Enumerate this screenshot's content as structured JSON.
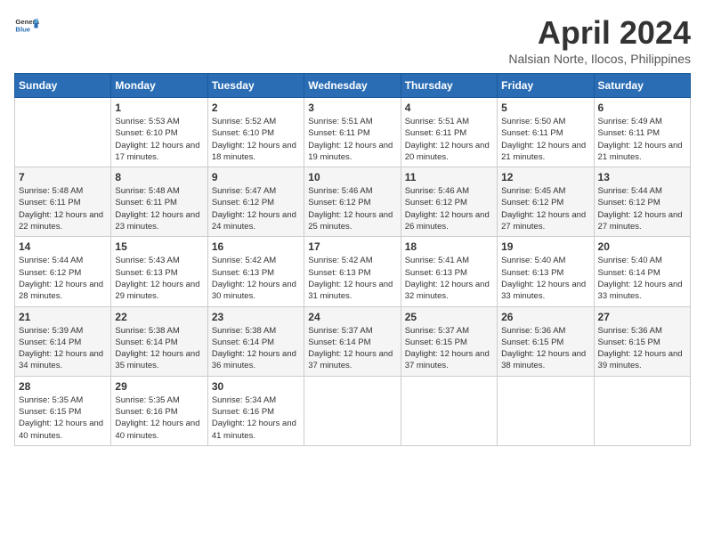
{
  "header": {
    "logo_general": "General",
    "logo_blue": "Blue",
    "month_title": "April 2024",
    "location": "Nalsian Norte, Ilocos, Philippines"
  },
  "calendar": {
    "weekdays": [
      "Sunday",
      "Monday",
      "Tuesday",
      "Wednesday",
      "Thursday",
      "Friday",
      "Saturday"
    ],
    "weeks": [
      [
        {
          "day": "",
          "sunrise": "",
          "sunset": "",
          "daylight": ""
        },
        {
          "day": "1",
          "sunrise": "Sunrise: 5:53 AM",
          "sunset": "Sunset: 6:10 PM",
          "daylight": "Daylight: 12 hours and 17 minutes."
        },
        {
          "day": "2",
          "sunrise": "Sunrise: 5:52 AM",
          "sunset": "Sunset: 6:10 PM",
          "daylight": "Daylight: 12 hours and 18 minutes."
        },
        {
          "day": "3",
          "sunrise": "Sunrise: 5:51 AM",
          "sunset": "Sunset: 6:11 PM",
          "daylight": "Daylight: 12 hours and 19 minutes."
        },
        {
          "day": "4",
          "sunrise": "Sunrise: 5:51 AM",
          "sunset": "Sunset: 6:11 PM",
          "daylight": "Daylight: 12 hours and 20 minutes."
        },
        {
          "day": "5",
          "sunrise": "Sunrise: 5:50 AM",
          "sunset": "Sunset: 6:11 PM",
          "daylight": "Daylight: 12 hours and 21 minutes."
        },
        {
          "day": "6",
          "sunrise": "Sunrise: 5:49 AM",
          "sunset": "Sunset: 6:11 PM",
          "daylight": "Daylight: 12 hours and 21 minutes."
        }
      ],
      [
        {
          "day": "7",
          "sunrise": "Sunrise: 5:48 AM",
          "sunset": "Sunset: 6:11 PM",
          "daylight": "Daylight: 12 hours and 22 minutes."
        },
        {
          "day": "8",
          "sunrise": "Sunrise: 5:48 AM",
          "sunset": "Sunset: 6:11 PM",
          "daylight": "Daylight: 12 hours and 23 minutes."
        },
        {
          "day": "9",
          "sunrise": "Sunrise: 5:47 AM",
          "sunset": "Sunset: 6:12 PM",
          "daylight": "Daylight: 12 hours and 24 minutes."
        },
        {
          "day": "10",
          "sunrise": "Sunrise: 5:46 AM",
          "sunset": "Sunset: 6:12 PM",
          "daylight": "Daylight: 12 hours and 25 minutes."
        },
        {
          "day": "11",
          "sunrise": "Sunrise: 5:46 AM",
          "sunset": "Sunset: 6:12 PM",
          "daylight": "Daylight: 12 hours and 26 minutes."
        },
        {
          "day": "12",
          "sunrise": "Sunrise: 5:45 AM",
          "sunset": "Sunset: 6:12 PM",
          "daylight": "Daylight: 12 hours and 27 minutes."
        },
        {
          "day": "13",
          "sunrise": "Sunrise: 5:44 AM",
          "sunset": "Sunset: 6:12 PM",
          "daylight": "Daylight: 12 hours and 27 minutes."
        }
      ],
      [
        {
          "day": "14",
          "sunrise": "Sunrise: 5:44 AM",
          "sunset": "Sunset: 6:12 PM",
          "daylight": "Daylight: 12 hours and 28 minutes."
        },
        {
          "day": "15",
          "sunrise": "Sunrise: 5:43 AM",
          "sunset": "Sunset: 6:13 PM",
          "daylight": "Daylight: 12 hours and 29 minutes."
        },
        {
          "day": "16",
          "sunrise": "Sunrise: 5:42 AM",
          "sunset": "Sunset: 6:13 PM",
          "daylight": "Daylight: 12 hours and 30 minutes."
        },
        {
          "day": "17",
          "sunrise": "Sunrise: 5:42 AM",
          "sunset": "Sunset: 6:13 PM",
          "daylight": "Daylight: 12 hours and 31 minutes."
        },
        {
          "day": "18",
          "sunrise": "Sunrise: 5:41 AM",
          "sunset": "Sunset: 6:13 PM",
          "daylight": "Daylight: 12 hours and 32 minutes."
        },
        {
          "day": "19",
          "sunrise": "Sunrise: 5:40 AM",
          "sunset": "Sunset: 6:13 PM",
          "daylight": "Daylight: 12 hours and 33 minutes."
        },
        {
          "day": "20",
          "sunrise": "Sunrise: 5:40 AM",
          "sunset": "Sunset: 6:14 PM",
          "daylight": "Daylight: 12 hours and 33 minutes."
        }
      ],
      [
        {
          "day": "21",
          "sunrise": "Sunrise: 5:39 AM",
          "sunset": "Sunset: 6:14 PM",
          "daylight": "Daylight: 12 hours and 34 minutes."
        },
        {
          "day": "22",
          "sunrise": "Sunrise: 5:38 AM",
          "sunset": "Sunset: 6:14 PM",
          "daylight": "Daylight: 12 hours and 35 minutes."
        },
        {
          "day": "23",
          "sunrise": "Sunrise: 5:38 AM",
          "sunset": "Sunset: 6:14 PM",
          "daylight": "Daylight: 12 hours and 36 minutes."
        },
        {
          "day": "24",
          "sunrise": "Sunrise: 5:37 AM",
          "sunset": "Sunset: 6:14 PM",
          "daylight": "Daylight: 12 hours and 37 minutes."
        },
        {
          "day": "25",
          "sunrise": "Sunrise: 5:37 AM",
          "sunset": "Sunset: 6:15 PM",
          "daylight": "Daylight: 12 hours and 37 minutes."
        },
        {
          "day": "26",
          "sunrise": "Sunrise: 5:36 AM",
          "sunset": "Sunset: 6:15 PM",
          "daylight": "Daylight: 12 hours and 38 minutes."
        },
        {
          "day": "27",
          "sunrise": "Sunrise: 5:36 AM",
          "sunset": "Sunset: 6:15 PM",
          "daylight": "Daylight: 12 hours and 39 minutes."
        }
      ],
      [
        {
          "day": "28",
          "sunrise": "Sunrise: 5:35 AM",
          "sunset": "Sunset: 6:15 PM",
          "daylight": "Daylight: 12 hours and 40 minutes."
        },
        {
          "day": "29",
          "sunrise": "Sunrise: 5:35 AM",
          "sunset": "Sunset: 6:16 PM",
          "daylight": "Daylight: 12 hours and 40 minutes."
        },
        {
          "day": "30",
          "sunrise": "Sunrise: 5:34 AM",
          "sunset": "Sunset: 6:16 PM",
          "daylight": "Daylight: 12 hours and 41 minutes."
        },
        {
          "day": "",
          "sunrise": "",
          "sunset": "",
          "daylight": ""
        },
        {
          "day": "",
          "sunrise": "",
          "sunset": "",
          "daylight": ""
        },
        {
          "day": "",
          "sunrise": "",
          "sunset": "",
          "daylight": ""
        },
        {
          "day": "",
          "sunrise": "",
          "sunset": "",
          "daylight": ""
        }
      ]
    ]
  }
}
